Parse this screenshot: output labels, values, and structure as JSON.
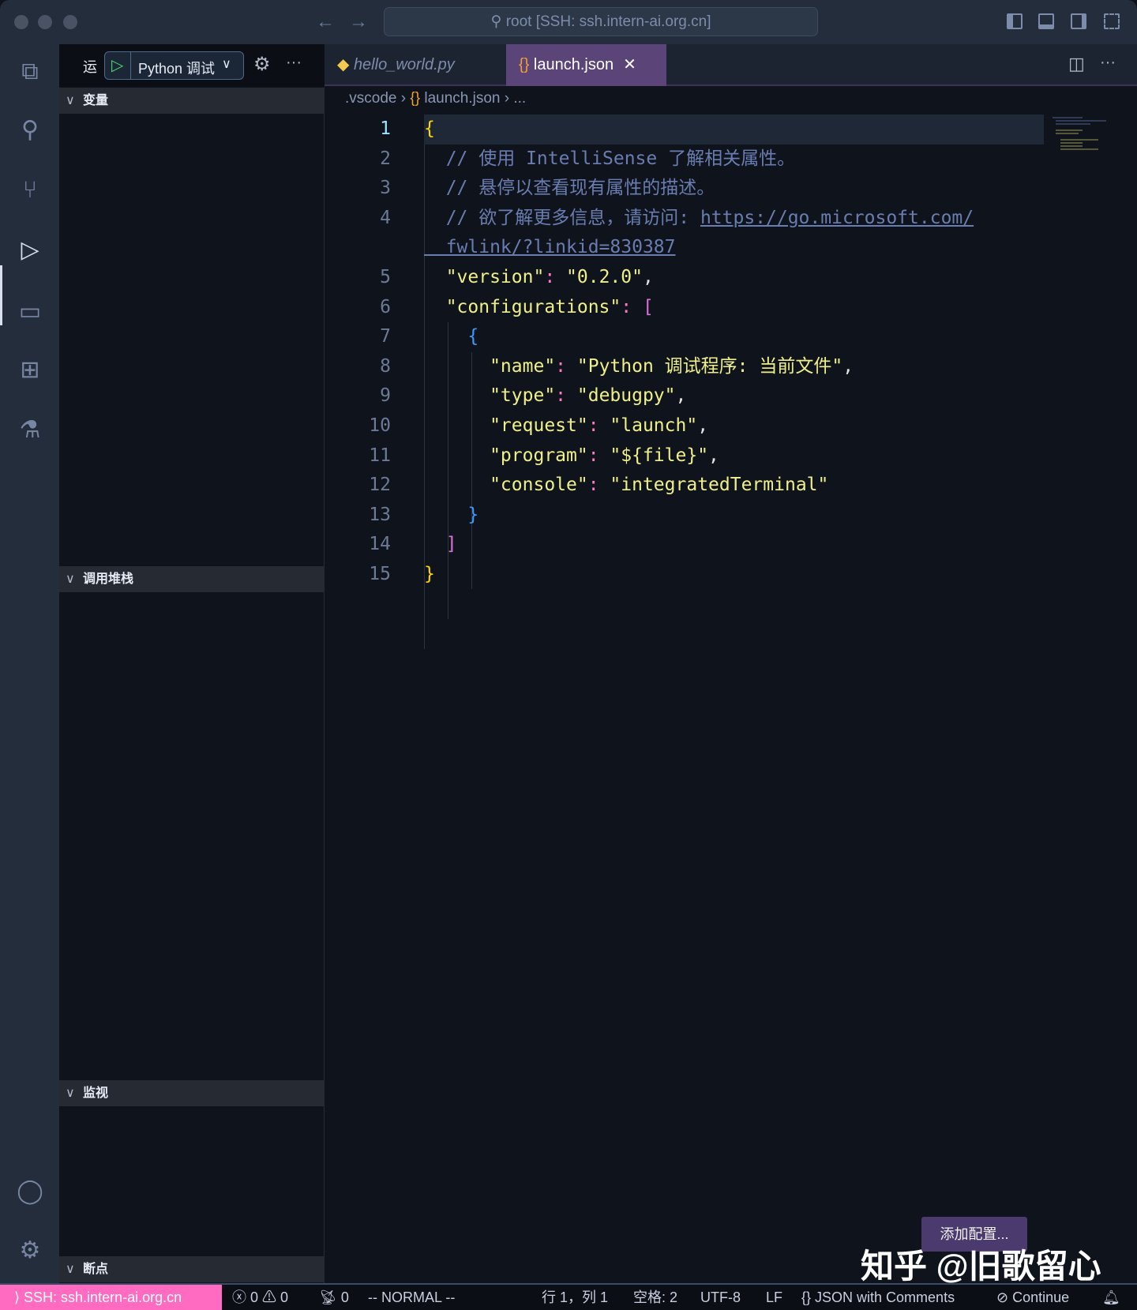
{
  "titlebar": {
    "command_center": "root [SSH: ssh.intern-ai.org.cn]"
  },
  "sidebar": {
    "run_label": "运",
    "config_select": "Python 调试",
    "sections": [
      "变量",
      "调用堆栈",
      "监视",
      "断点"
    ]
  },
  "tabs": [
    {
      "label": "hello_world.py",
      "active": false
    },
    {
      "label": "launch.json",
      "active": true
    }
  ],
  "breadcrumb": [
    ".vscode",
    "launch.json",
    "..."
  ],
  "code": {
    "current_line": 1,
    "lines": [
      {
        "n": "1",
        "t": [
          [
            "c-b1",
            "{"
          ]
        ]
      },
      {
        "n": "2",
        "t": [
          [
            "c-cm",
            "  // 使用 IntelliSense 了解相关属性。"
          ]
        ]
      },
      {
        "n": "3",
        "t": [
          [
            "c-cm",
            "  // 悬停以查看现有属性的描述。"
          ]
        ]
      },
      {
        "n": "4",
        "t": [
          [
            "c-cm",
            "  // 欲了解更多信息，请访问: "
          ],
          [
            "c-url",
            "https://go.microsoft.com/"
          ]
        ]
      },
      {
        "n": "",
        "t": [
          [
            "c-url",
            "  fwlink/?linkid=830387"
          ]
        ]
      },
      {
        "n": "5",
        "t": [
          [
            "c-key",
            "  \"version\""
          ],
          [
            "c-colon",
            ": "
          ],
          [
            "c-str",
            "\"0.2.0\""
          ],
          [
            "c-p",
            ","
          ]
        ]
      },
      {
        "n": "6",
        "t": [
          [
            "c-key",
            "  \"configurations\""
          ],
          [
            "c-colon",
            ": "
          ],
          [
            "c-b2",
            "["
          ]
        ]
      },
      {
        "n": "7",
        "t": [
          [
            "c-b3",
            "    {"
          ]
        ]
      },
      {
        "n": "8",
        "t": [
          [
            "c-key",
            "      \"name\""
          ],
          [
            "c-colon",
            ": "
          ],
          [
            "c-str",
            "\"Python 调试程序: 当前文件\""
          ],
          [
            "c-p",
            ","
          ]
        ]
      },
      {
        "n": "9",
        "t": [
          [
            "c-key",
            "      \"type\""
          ],
          [
            "c-colon",
            ": "
          ],
          [
            "c-str",
            "\"debugpy\""
          ],
          [
            "c-p",
            ","
          ]
        ]
      },
      {
        "n": "10",
        "t": [
          [
            "c-key",
            "      \"request\""
          ],
          [
            "c-colon",
            ": "
          ],
          [
            "c-str",
            "\"launch\""
          ],
          [
            "c-p",
            ","
          ]
        ]
      },
      {
        "n": "11",
        "t": [
          [
            "c-key",
            "      \"program\""
          ],
          [
            "c-colon",
            ": "
          ],
          [
            "c-str",
            "\"${file}\""
          ],
          [
            "c-p",
            ","
          ]
        ]
      },
      {
        "n": "12",
        "t": [
          [
            "c-key",
            "      \"console\""
          ],
          [
            "c-colon",
            ": "
          ],
          [
            "c-str",
            "\"integratedTerminal\""
          ]
        ]
      },
      {
        "n": "13",
        "t": [
          [
            "c-b3",
            "    }"
          ]
        ]
      },
      {
        "n": "14",
        "t": [
          [
            "c-b2",
            "  ]"
          ]
        ]
      },
      {
        "n": "15",
        "t": [
          [
            "c-b1",
            "}"
          ]
        ]
      }
    ]
  },
  "add_config_button": "添加配置...",
  "watermark": "知乎 @旧歌留心",
  "statusbar": {
    "remote": "SSH: ssh.intern-ai.org.cn",
    "errors": "0",
    "warnings": "0",
    "ports": "0",
    "vim_mode": "-- NORMAL --",
    "position": "行 1，列 1",
    "indent": "空格: 2",
    "encoding": "UTF-8",
    "eol": "LF",
    "language": "JSON with Comments",
    "continue": "Continue"
  },
  "colors": {
    "accent": "#ff6bc1",
    "tab_active": "#5a4478"
  }
}
